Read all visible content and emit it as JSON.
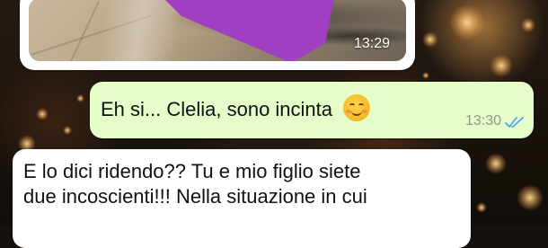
{
  "image_message": {
    "time": "13:29"
  },
  "outgoing_message": {
    "text": "Eh si... Clelia, sono incinta",
    "emoji": "smiling-face-with-blush",
    "time": "13:30",
    "status": "read"
  },
  "incoming_message": {
    "line1": "E lo dici ridendo?? Tu e mio figlio siete",
    "line2": "due incoscienti!!! Nella situazione in cui",
    "line3": ""
  },
  "colors": {
    "outgoing_bubble": "#e4fdc9",
    "incoming_bubble": "#ffffff",
    "read_ticks": "#4fa6e8",
    "redaction_overlay": "#a03fc1"
  }
}
